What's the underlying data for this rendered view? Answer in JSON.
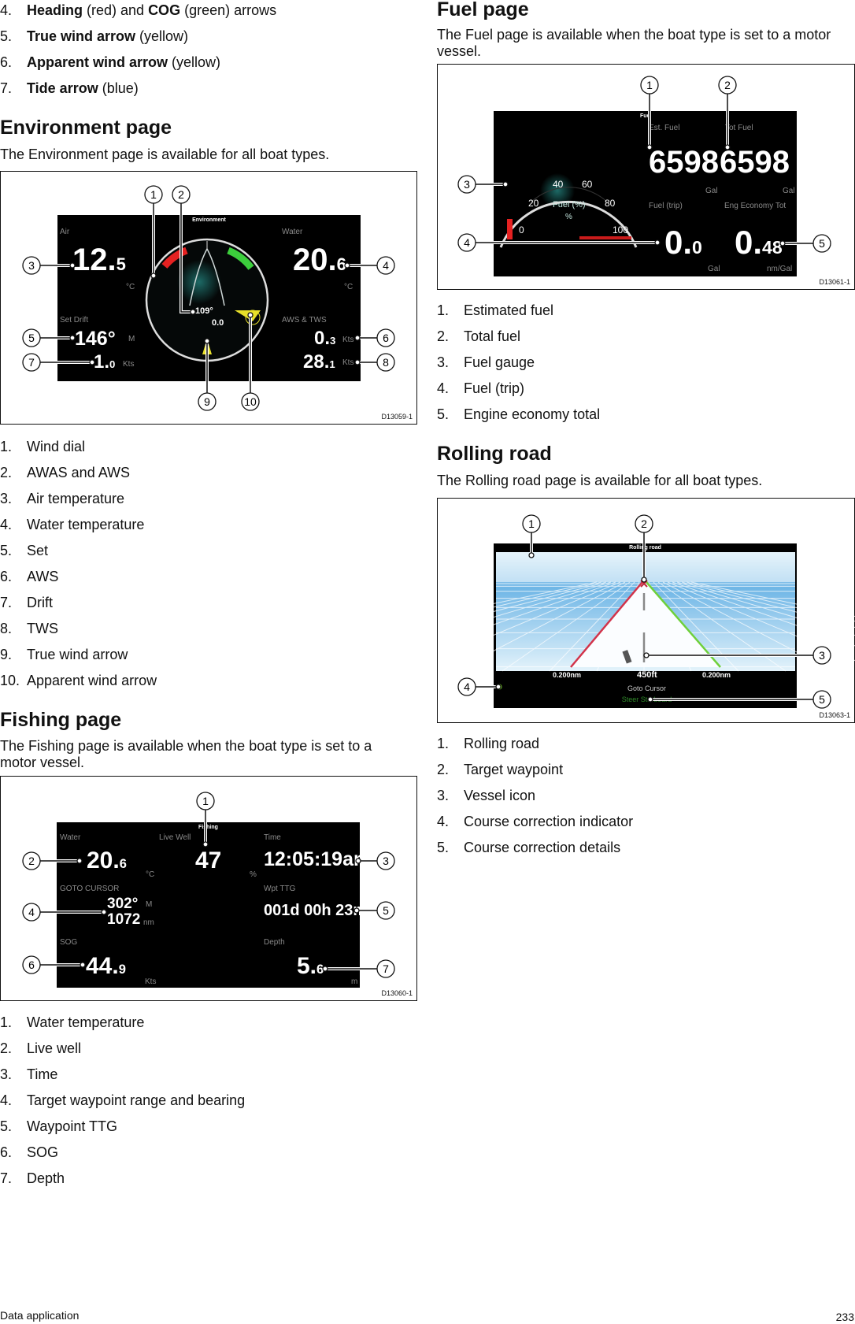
{
  "intro_list": [
    {
      "num": "4.",
      "parts": [
        {
          "b": true,
          "t": "Heading"
        },
        {
          "b": false,
          "t": " (red) and "
        },
        {
          "b": true,
          "t": "COG"
        },
        {
          "b": false,
          "t": " (green) arrows"
        }
      ]
    },
    {
      "num": "5.",
      "parts": [
        {
          "b": true,
          "t": "True wind arrow"
        },
        {
          "b": false,
          "t": " (yellow)"
        }
      ]
    },
    {
      "num": "6.",
      "parts": [
        {
          "b": true,
          "t": "Apparent wind arrow"
        },
        {
          "b": false,
          "t": " (yellow)"
        }
      ]
    },
    {
      "num": "7.",
      "parts": [
        {
          "b": true,
          "t": "Tide arrow"
        },
        {
          "b": false,
          "t": " (blue)"
        }
      ]
    }
  ],
  "environment": {
    "heading": "Environment page",
    "description": "The Environment page is available for all boat types.",
    "figure": {
      "id": "D13059-1",
      "screen_title": "Environment",
      "air_label": "Air",
      "air_main": "12.",
      "air_sub": "5",
      "air_unit": "°C",
      "water_label": "Water",
      "water_main": "20.",
      "water_sub": "6",
      "water_unit": "°C",
      "setdrift_label": "Set Drift",
      "set_value": "146°",
      "set_unit": "M",
      "drift_main": "1.",
      "drift_sub": "0",
      "drift_unit": "Kts",
      "awstws_label": "AWS & TWS",
      "aws_main": "0.",
      "aws_sub": "3",
      "aws_unit": "Kts",
      "tws_main": "28.",
      "tws_sub": "1",
      "tws_unit": "Kts",
      "dial_awa": "109°",
      "dial_aws": "0.0",
      "callouts": [
        "1",
        "2",
        "3",
        "4",
        "5",
        "6",
        "7",
        "8",
        "9",
        "10"
      ]
    },
    "items": [
      "Wind dial",
      "AWAS and AWS",
      "Air temperature",
      "Water temperature",
      "Set",
      "AWS",
      "Drift",
      "TWS",
      "True wind arrow",
      "Apparent wind arrow"
    ]
  },
  "fishing": {
    "heading": "Fishing page",
    "description": "The Fishing page is available when the boat type is set to a motor vessel.",
    "figure": {
      "id": "D13060-1",
      "screen_title": "Fishing",
      "water_label": "Water",
      "water_main": "20.",
      "water_sub": "6",
      "water_unit": "°C",
      "livewell_label": "Live Well",
      "livewell_value": "47",
      "livewell_unit": "%",
      "time_label": "Time",
      "time_value": "12:05:19am",
      "goto_label": "GOTO CURSOR",
      "bearing": "302°",
      "bearing_unit": "M",
      "range": "1072",
      "range_unit": "nm",
      "ttg_label": "Wpt TTG",
      "ttg_value": "001d 00h 23m",
      "sog_label": "SOG",
      "sog_main": "44.",
      "sog_sub": "9",
      "sog_unit": "Kts",
      "depth_label": "Depth",
      "depth_main": "5.",
      "depth_sub": "6",
      "depth_unit": "m",
      "callouts": [
        "1",
        "2",
        "3",
        "4",
        "5",
        "6",
        "7"
      ]
    },
    "items": [
      "Water temperature",
      "Live well",
      "Time",
      "Target waypoint range and bearing",
      "Waypoint TTG",
      "SOG",
      "Depth"
    ]
  },
  "fuel": {
    "heading": "Fuel page",
    "description": "The Fuel page is available when the boat type is set to a motor vessel.",
    "figure": {
      "id": "D13061-1",
      "screen_title": "Fuel",
      "est_label": "Est. Fuel",
      "est_value": "6598",
      "est_unit": "Gal",
      "tot_label": "Tot Fuel",
      "tot_value": "6598",
      "tot_unit": "Gal",
      "trip_label": "Fuel (trip)",
      "trip_main": "0.",
      "trip_sub": "0",
      "trip_unit": "Gal",
      "eco_label": "Eng Economy Tot",
      "eco_main": "0.",
      "eco_sub": "48",
      "eco_unit": "nm/Gal",
      "gauge_title": "Fuel (%)",
      "gauge_unit": "%",
      "gauge_ticks": [
        "0",
        "20",
        "40",
        "60",
        "80",
        "100"
      ],
      "callouts": [
        "1",
        "2",
        "3",
        "4",
        "5"
      ]
    },
    "items": [
      "Estimated fuel",
      "Total fuel",
      "Fuel gauge",
      "Fuel (trip)",
      "Engine economy total"
    ]
  },
  "rolling": {
    "heading": "Rolling road",
    "description": "The Rolling road page is available for all boat types.",
    "figure": {
      "id": "D13063-1",
      "screen_title": "Rolling road",
      "xte_left": "0.200nm",
      "distance": "450ft",
      "xte_right": "0.200nm",
      "destination": "Goto Cursor",
      "steer": "Steer Starboard",
      "callouts": [
        "1",
        "2",
        "3",
        "4",
        "5"
      ]
    },
    "items": [
      "Rolling road",
      "Target waypoint",
      "Vessel icon",
      "Course correction indicator",
      "Course correction details"
    ]
  },
  "footer": {
    "section": "Data application",
    "page": "233"
  },
  "colors": {
    "heading_arrow": "#e52121",
    "cog_arrow": "#3ccf3c",
    "wind_arrow": "#e8e02a",
    "sky": "#8ecdf0"
  }
}
